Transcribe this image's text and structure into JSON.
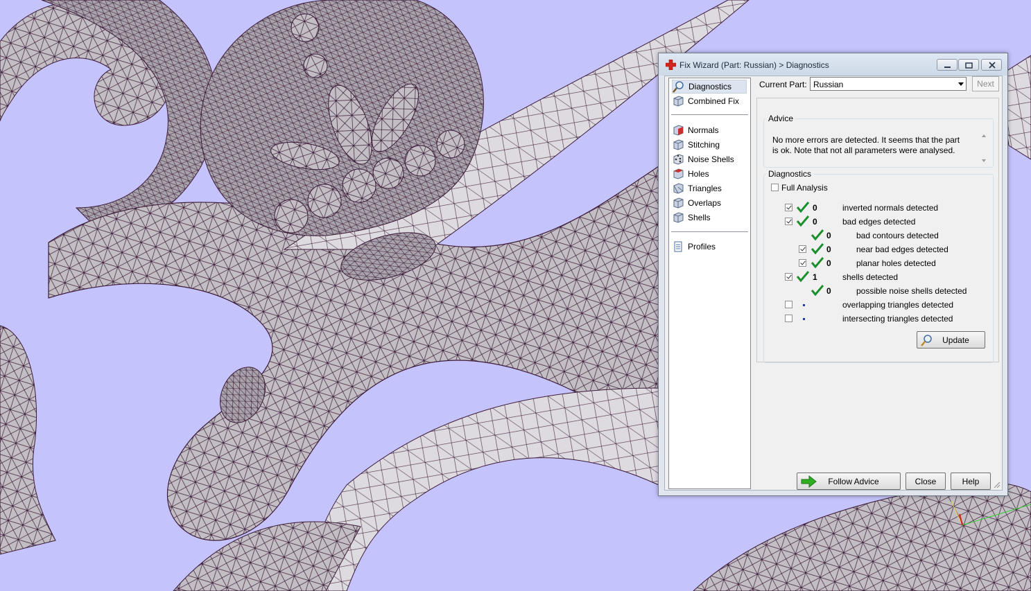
{
  "colors": {
    "viewport_background": "#c4c3fb",
    "mesh_fill": "#b9b4ba",
    "mesh_line": "#3b1a37",
    "check_green": "#1b8f2b",
    "arrow_green": "#2fae22"
  },
  "window": {
    "title": "Fix Wizard (Part: Russian) > Diagnostics",
    "icon": "red-cross-icon"
  },
  "nav": {
    "items": [
      {
        "label": "Diagnostics",
        "icon": "magnifier-icon",
        "selected": true
      },
      {
        "label": "Combined Fix",
        "icon": "cube-icon"
      },
      {
        "label": "Normals",
        "icon": "red-cube-icon"
      },
      {
        "label": "Stitching",
        "icon": "cube-icon"
      },
      {
        "label": "Noise Shells",
        "icon": "dice-icon"
      },
      {
        "label": "Holes",
        "icon": "red-cube-icon"
      },
      {
        "label": "Triangles",
        "icon": "cube-icon"
      },
      {
        "label": "Overlaps",
        "icon": "cube-icon"
      },
      {
        "label": "Shells",
        "icon": "cube-icon"
      },
      {
        "label": "Profiles",
        "icon": "document-icon"
      }
    ]
  },
  "current_part": {
    "label": "Current Part:",
    "value": "Russian",
    "next_label": "Next"
  },
  "advice": {
    "legend": "Advice",
    "text": "No more errors are detected. It seems that the part is ok. Note that not all parameters were analysed."
  },
  "diagnostics": {
    "legend": "Diagnostics",
    "full_analysis_label": "Full Analysis",
    "full_analysis_checked": false,
    "rows": [
      {
        "checkbox": true,
        "checked": true,
        "status": "ok",
        "count": "0",
        "label": "inverted normals detected"
      },
      {
        "checkbox": true,
        "checked": true,
        "status": "ok",
        "count": "0",
        "label": "bad edges detected"
      },
      {
        "checkbox": false,
        "status": "ok",
        "count": "0",
        "label": "bad contours detected",
        "sub": true
      },
      {
        "checkbox": true,
        "checked": true,
        "status": "ok",
        "count": "0",
        "label": "near bad edges detected",
        "sub": true
      },
      {
        "checkbox": true,
        "checked": true,
        "status": "ok",
        "count": "0",
        "label": "planar holes detected",
        "sub": true
      },
      {
        "checkbox": true,
        "checked": true,
        "status": "ok",
        "count": "1",
        "label": "shells detected"
      },
      {
        "checkbox": false,
        "status": "ok",
        "count": "0",
        "label": "possible noise shells detected",
        "sub": true
      },
      {
        "checkbox": true,
        "checked": false,
        "status": "not-analysed",
        "count": "",
        "label": "overlapping triangles detected"
      },
      {
        "checkbox": true,
        "checked": false,
        "status": "not-analysed",
        "count": "",
        "label": "intersecting triangles detected"
      }
    ],
    "update_label": "Update"
  },
  "footer": {
    "follow_advice_label": "Follow Advice",
    "close_label": "Close",
    "help_label": "Help"
  }
}
